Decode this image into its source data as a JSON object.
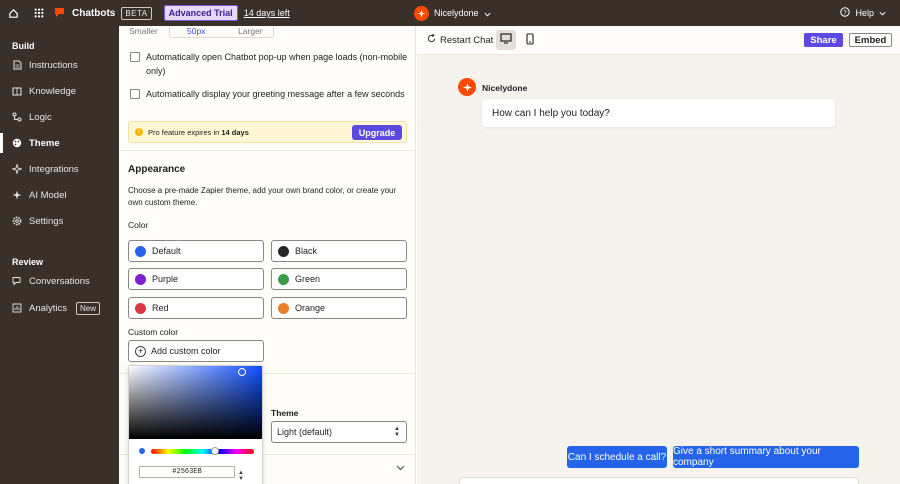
{
  "topbar": {
    "brand": "Chatbots",
    "beta_label": "BETA",
    "trial_label": "Advanced Trial",
    "days_left": "14 days left",
    "account_name": "Nicelydone",
    "help_label": "Help"
  },
  "sidebar": {
    "build_section": "Build",
    "review_section": "Review",
    "build_items": [
      {
        "label": "Instructions",
        "icon": "document-icon"
      },
      {
        "label": "Knowledge",
        "icon": "book-icon"
      },
      {
        "label": "Logic",
        "icon": "logic-icon"
      },
      {
        "label": "Theme",
        "icon": "palette-icon",
        "active": true
      },
      {
        "label": "Integrations",
        "icon": "plug-icon"
      },
      {
        "label": "AI Model",
        "icon": "sparkle-icon"
      },
      {
        "label": "Settings",
        "icon": "gear-icon"
      }
    ],
    "review_items": [
      {
        "label": "Conversations",
        "icon": "chat-icon"
      },
      {
        "label": "Analytics",
        "icon": "chart-icon",
        "badge": "New"
      }
    ]
  },
  "panel": {
    "sizes": [
      "Smaller",
      "50px",
      "Larger"
    ],
    "checkbox_popup": "Automatically open Chatbot pop-up when page loads (non-mobile only)",
    "checkbox_greeting": "Automatically display your greeting message after a few seconds",
    "pro_prefix": "Pro feature expires in ",
    "pro_days": "14 days",
    "upgrade_label": "Upgrade",
    "appearance_heading": "Appearance",
    "appearance_desc": "Choose a pre-made Zapier theme, add your own brand color, or create your own custom theme.",
    "color_label": "Color",
    "colors": [
      {
        "name": "Default",
        "hex": "#2563eb"
      },
      {
        "name": "Black",
        "hex": "#262626"
      },
      {
        "name": "Purple",
        "hex": "#7e22ce"
      },
      {
        "name": "Green",
        "hex": "#3c9a4a"
      },
      {
        "name": "Red",
        "hex": "#dc3545"
      },
      {
        "name": "Orange",
        "hex": "#ea7d28"
      }
    ],
    "custom_color_label": "Custom color",
    "add_custom_label": "Add custom color",
    "picker_hex": "#2563EB",
    "theme_label": "Theme",
    "theme_value": "Light (default)"
  },
  "preview": {
    "restart_label": "Restart Chat",
    "share_label": "Share",
    "embed_label": "Embed",
    "bot_name": "Nicelydone",
    "greeting": "How can I help you today?",
    "suggestions": [
      "Can I schedule a call?",
      "Give a short summary about your company"
    ]
  }
}
